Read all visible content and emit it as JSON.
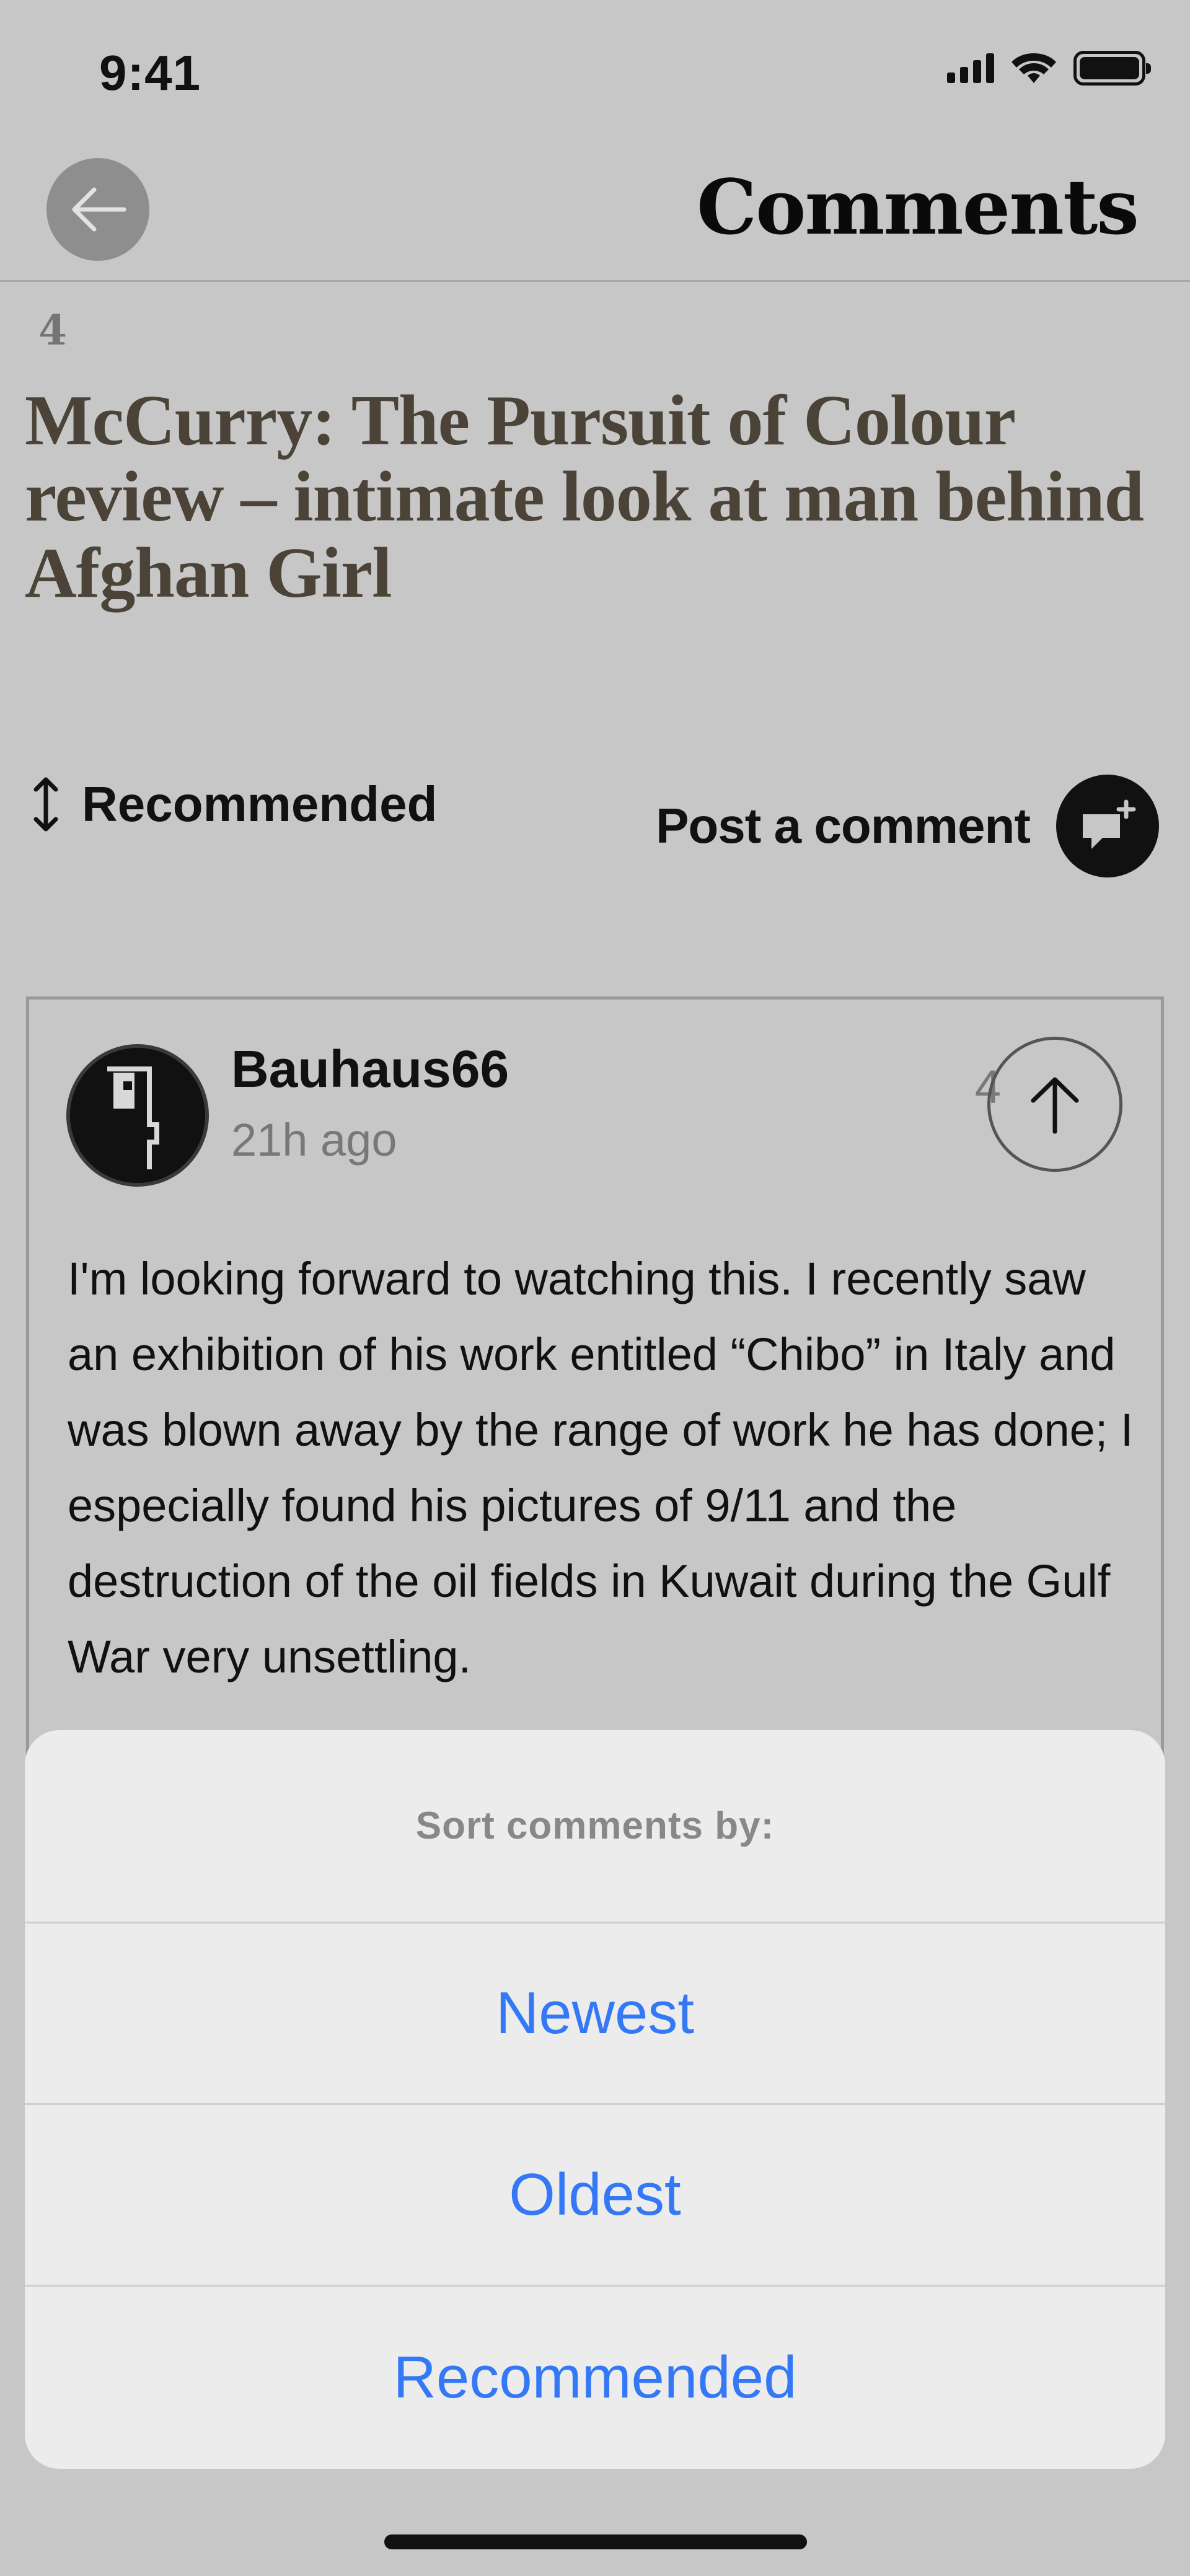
{
  "status_bar": {
    "time": "9:41"
  },
  "nav": {
    "title": "Comments"
  },
  "article": {
    "comment_count": "4",
    "title": "McCurry: The Pursuit of Colour review – intimate look at man behind Afghan Girl"
  },
  "toolbar": {
    "sort_label": "Recommended",
    "post_label": "Post a comment"
  },
  "comment": {
    "author": "Bauhaus66",
    "time_ago": "21h ago",
    "votes": "4",
    "body": "I'm looking forward to watching this. I recently saw an exhibition of his work entitled “Chibo” in Italy and was blown away by the range of work he has done; I especially found his pictures of 9/11 and the destruction of the oil fields in Kuwait during the Gulf War very unsettling."
  },
  "sort_sheet": {
    "title": "Sort comments by:",
    "options": [
      "Newest",
      "Oldest",
      "Recommended"
    ]
  },
  "colors": {
    "accent": "#3478f6",
    "background": "#c7c7c7",
    "title_text": "#4b4338"
  },
  "icons": {
    "back": "arrow-left-icon",
    "sort": "sort-arrows-icon",
    "post": "chat-plus-icon",
    "upvote": "arrow-up-icon"
  }
}
